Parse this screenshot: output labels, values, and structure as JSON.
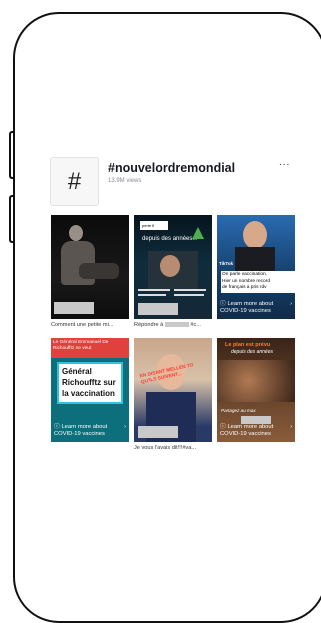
{
  "header": {
    "hash_symbol": "#",
    "title": "#nouvelordremondial",
    "views": "13.9M views",
    "more": "..."
  },
  "tiles": [
    {
      "caption": "Comment une petite mi..."
    },
    {
      "caption": "Répondre à",
      "caption_end": "#c...",
      "overlay_top": "depuis des années...",
      "overlay_label": "perte fi"
    },
    {
      "overlay_lines": [
        "On parle vaccination.",
        "Hier un nombre record",
        "de français a pris rdv"
      ],
      "learn_more": "Learn more about COVID-19 vaccines",
      "brand": "TikTok"
    },
    {
      "overlay_header": "Le Général Emmanuel De Richoufftz ne veut",
      "overlay_title": "Général Richoufftz sur la vaccination",
      "learn_more": "Learn more about COVID-19 vaccines"
    },
    {
      "caption": "Je vous l'avais dit!!!#va...",
      "overlay_text": "EN DISANT MELLEN TO QU'ILS SUIVENT..."
    },
    {
      "overlay_top": "Le plan est prévu",
      "overlay_sub": "depuis des années",
      "overlay_mid": "Partagez au max",
      "learn_more": "Learn more about COVID-19 vaccines"
    }
  ],
  "colors": {
    "title": "#161823",
    "muted": "#8a8b91",
    "tile4_bg": "#0c6f7b"
  }
}
